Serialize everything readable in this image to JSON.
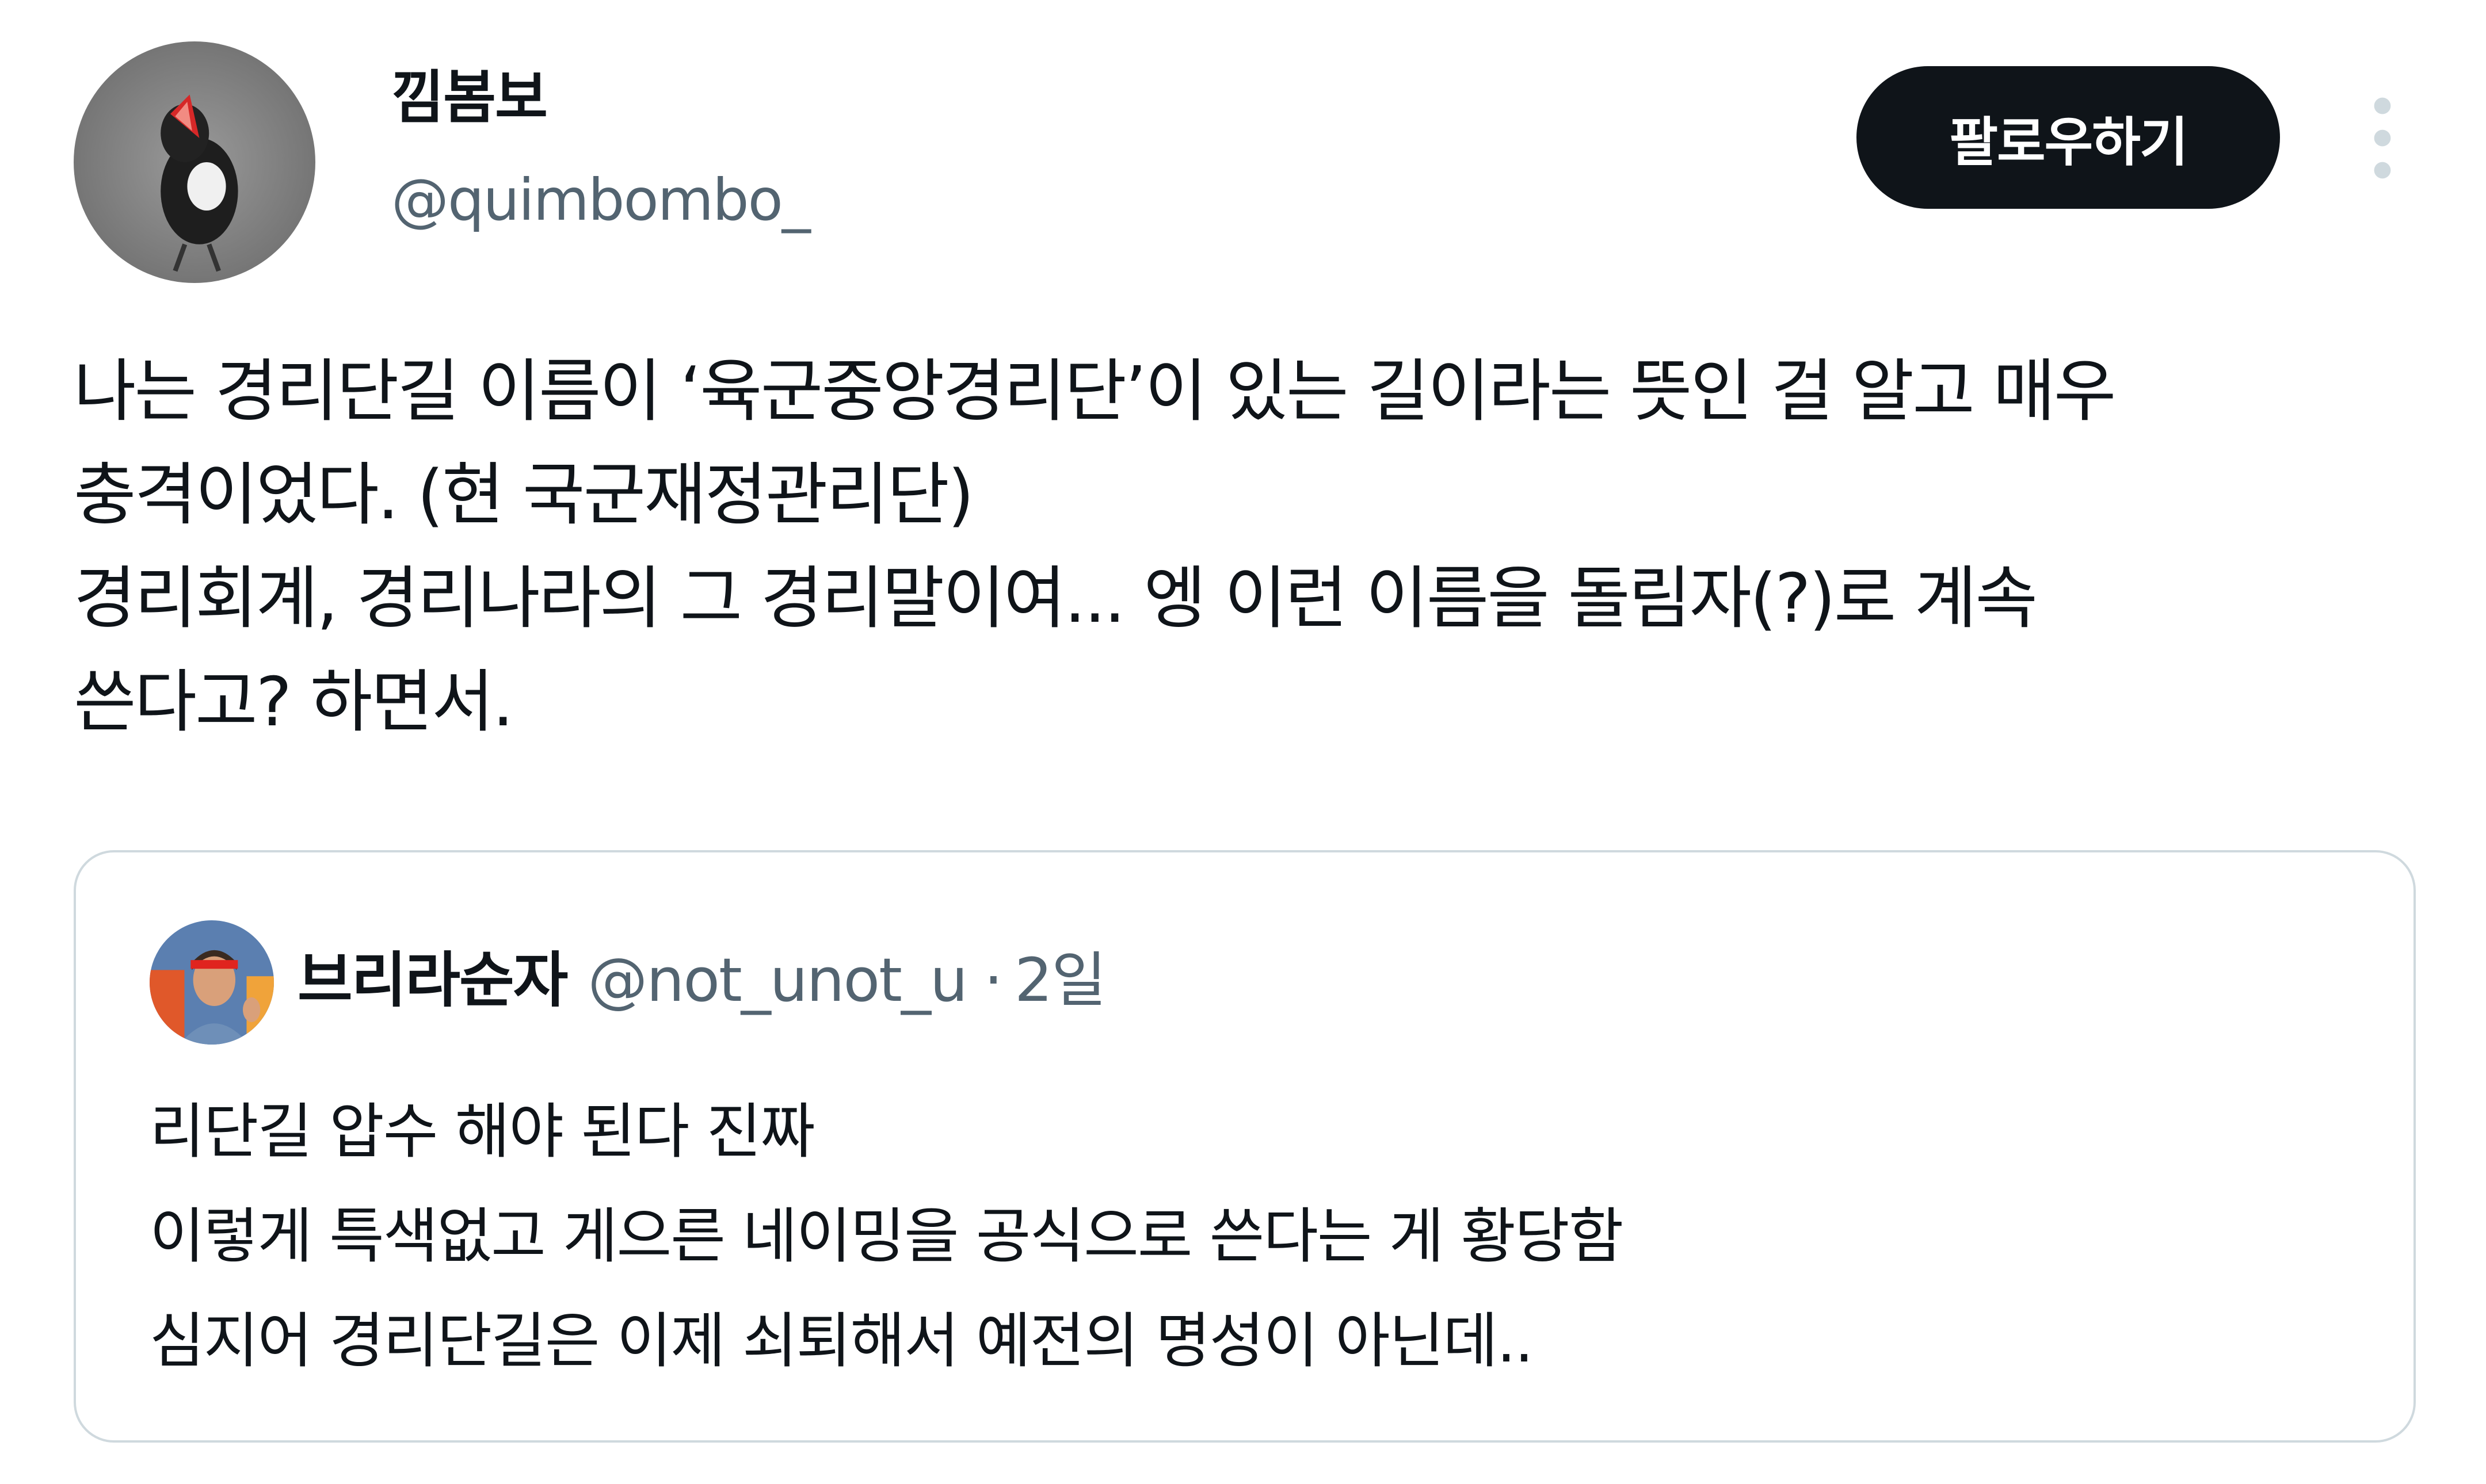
{
  "author": {
    "display_name": "낌봄보",
    "handle": "@quimbombo_",
    "avatar_icon": "bird-avatar-icon"
  },
  "actions": {
    "follow_label": "팔로우하기",
    "more_icon": "more-vertical-icon"
  },
  "tweet": {
    "lines": [
      "나는 경리단길 이름이 ‘육군중앙경리단’이 있는 길이라는 뜻인 걸 알고 매우",
      "충격이었다. (현 국군재정관리단)",
      "경리회계, 경리나라의 그 경리말이여... 엥 이런 이름을 돌림자(?)로 계속",
      "쓴다고? 하면서."
    ]
  },
  "quoted_tweet": {
    "display_name": "브리라순자",
    "handle": "@not_unot_u",
    "separator": "·",
    "time": "2일",
    "avatar_icon": "person-avatar-icon",
    "lines": [
      "리단길 압수 해야 된다 진짜",
      "이렇게 특색없고 게으른 네이밍을 공식으로 쓴다는 게 황당함",
      "심지어 경리단길은 이제 쇠퇴해서 예전의 명성이 아닌데.."
    ]
  },
  "colors": {
    "text_primary": "#0f1419",
    "text_secondary": "#536471",
    "border": "#cfd9de",
    "button_bg": "#0f1419",
    "button_text": "#ffffff"
  }
}
